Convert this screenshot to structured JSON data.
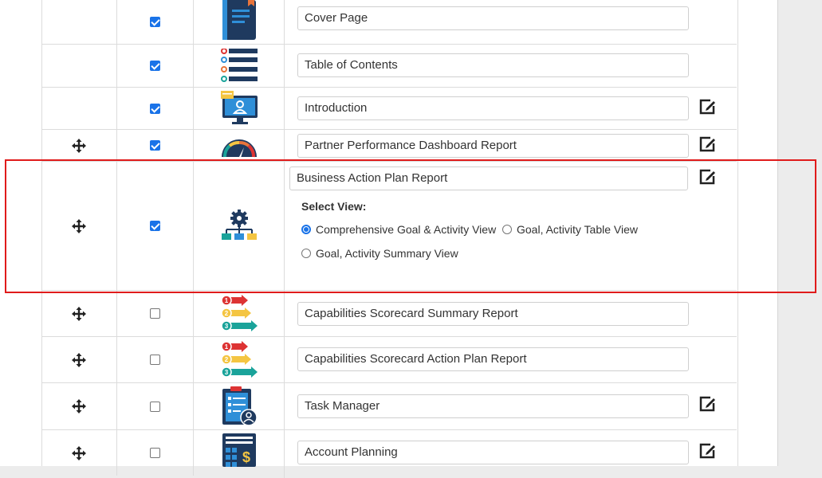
{
  "rows": [
    {
      "label": "Cover Page",
      "checked": true,
      "icon": "cover-page-book-icon",
      "movable": false,
      "editable": false
    },
    {
      "label": "Table of Contents",
      "checked": true,
      "icon": "list-icon",
      "movable": false,
      "editable": false
    },
    {
      "label": "Introduction",
      "checked": true,
      "icon": "monitor-user-icon",
      "movable": false,
      "editable": true
    },
    {
      "label": "Partner Performance Dashboard Report",
      "checked": true,
      "icon": "gauge-icon",
      "movable": true,
      "editable": true
    },
    {
      "label": "Business Action Plan Report",
      "checked": true,
      "icon": "gear-hierarchy-icon",
      "movable": true,
      "editable": true
    },
    {
      "label": "Capabilities Scorecard Summary Report",
      "checked": false,
      "icon": "numbered-arrows-icon",
      "movable": true,
      "editable": false
    },
    {
      "label": "Capabilities Scorecard Action Plan Report",
      "checked": false,
      "icon": "numbered-arrows-icon",
      "movable": true,
      "editable": false
    },
    {
      "label": "Task Manager",
      "checked": false,
      "icon": "clipboard-user-icon",
      "movable": true,
      "editable": true
    },
    {
      "label": "Account Planning",
      "checked": false,
      "icon": "calculator-dollar-icon",
      "movable": true,
      "editable": true
    }
  ],
  "select_view": {
    "title": "Select View:",
    "options": [
      {
        "label": "Comprehensive Goal & Activity View",
        "selected": true
      },
      {
        "label": "Goal, Activity Table View",
        "selected": false
      },
      {
        "label": "Goal, Activity Summary View",
        "selected": false
      }
    ]
  },
  "colors": {
    "accent": "#1a73e8",
    "highlight": "#e01b1b",
    "icon_navy": "#1f3a5f",
    "icon_blue": "#2f8fd8"
  }
}
